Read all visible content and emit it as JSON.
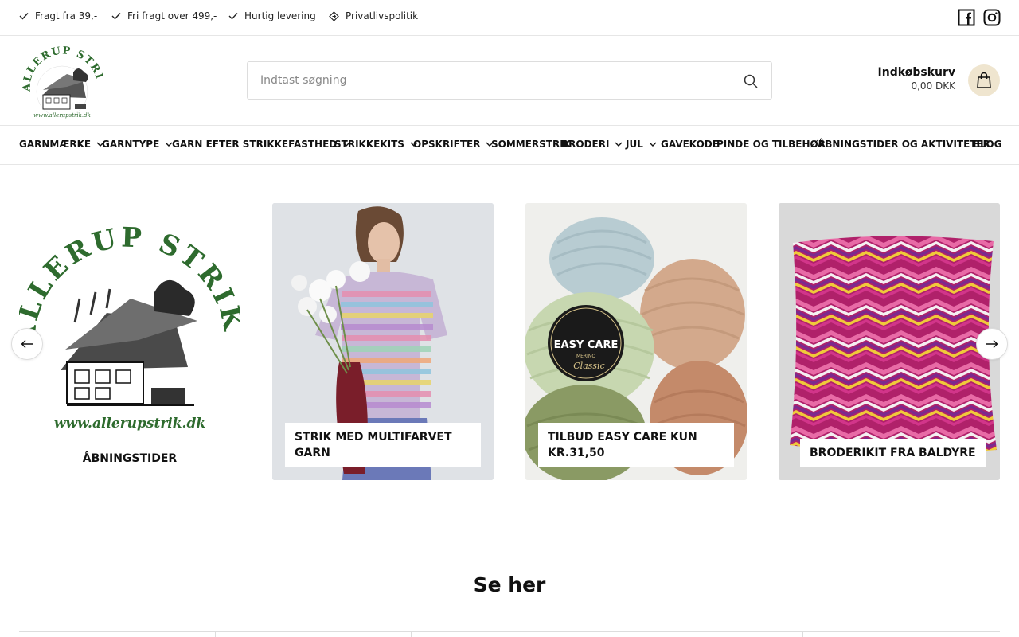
{
  "topbar": {
    "usps": [
      {
        "label": "Fragt fra 39,-",
        "icon": "check-icon"
      },
      {
        "label": "Fri fragt over 499,-",
        "icon": "check-icon"
      },
      {
        "label": "Hurtig levering",
        "icon": "check-icon"
      },
      {
        "label": "Privatlivspolitik",
        "icon": "diamond-icon"
      }
    ],
    "social": [
      "facebook-icon",
      "instagram-icon"
    ]
  },
  "header": {
    "logo_text": "ALLERUP STRIK",
    "logo_url_text": "www.allerupstrik.dk",
    "search": {
      "placeholder": "Indtast søgning",
      "value": ""
    },
    "cart": {
      "title": "Indkøbskurv",
      "total": "0,00 DKK"
    }
  },
  "nav": {
    "items": [
      {
        "label": "GARNMÆRKE",
        "dropdown": true
      },
      {
        "label": "GARNTYPE",
        "dropdown": true
      },
      {
        "label": "GARN EFTER STRIKKEFASTHED",
        "dropdown": true
      },
      {
        "label": "STRIKKEKITS",
        "dropdown": true
      },
      {
        "label": "OPSKRIFTER",
        "dropdown": true
      },
      {
        "label": "SOMMERSTRIK",
        "dropdown": false
      },
      {
        "label": "BRODERI",
        "dropdown": true
      },
      {
        "label": "JUL",
        "dropdown": true
      },
      {
        "label": "GAVEKODE",
        "dropdown": false
      },
      {
        "label": "PINDE OG TILBEHØR",
        "dropdown": false
      },
      {
        "label": "ÅBNINGSTIDER OG AKTIVITETER",
        "dropdown": false
      },
      {
        "label": "BLOG",
        "dropdown": false
      }
    ]
  },
  "carousel": {
    "cards": [
      {
        "label": "ÅBNINGSTIDER",
        "logo_text": "ALLERUP STRIK",
        "logo_url_text": "www.allerupstrik.dk"
      },
      {
        "label": "STRIK MED MULTIFARVET GARN"
      },
      {
        "label": "TILBUD EASY CARE KUN KR.31,50",
        "yarn_label_1": "EASY CARE",
        "yarn_label_2": "MERINO",
        "yarn_label_3": "Classic"
      },
      {
        "label": "BRODERIKIT FRA BALDYRE"
      }
    ],
    "prev_icon": "arrow-left-icon",
    "next_icon": "arrow-right-icon"
  },
  "section": {
    "title": "Se her"
  },
  "colors": {
    "cart_bg": "#efe5cf",
    "logo_green": "#2e6b2e"
  }
}
